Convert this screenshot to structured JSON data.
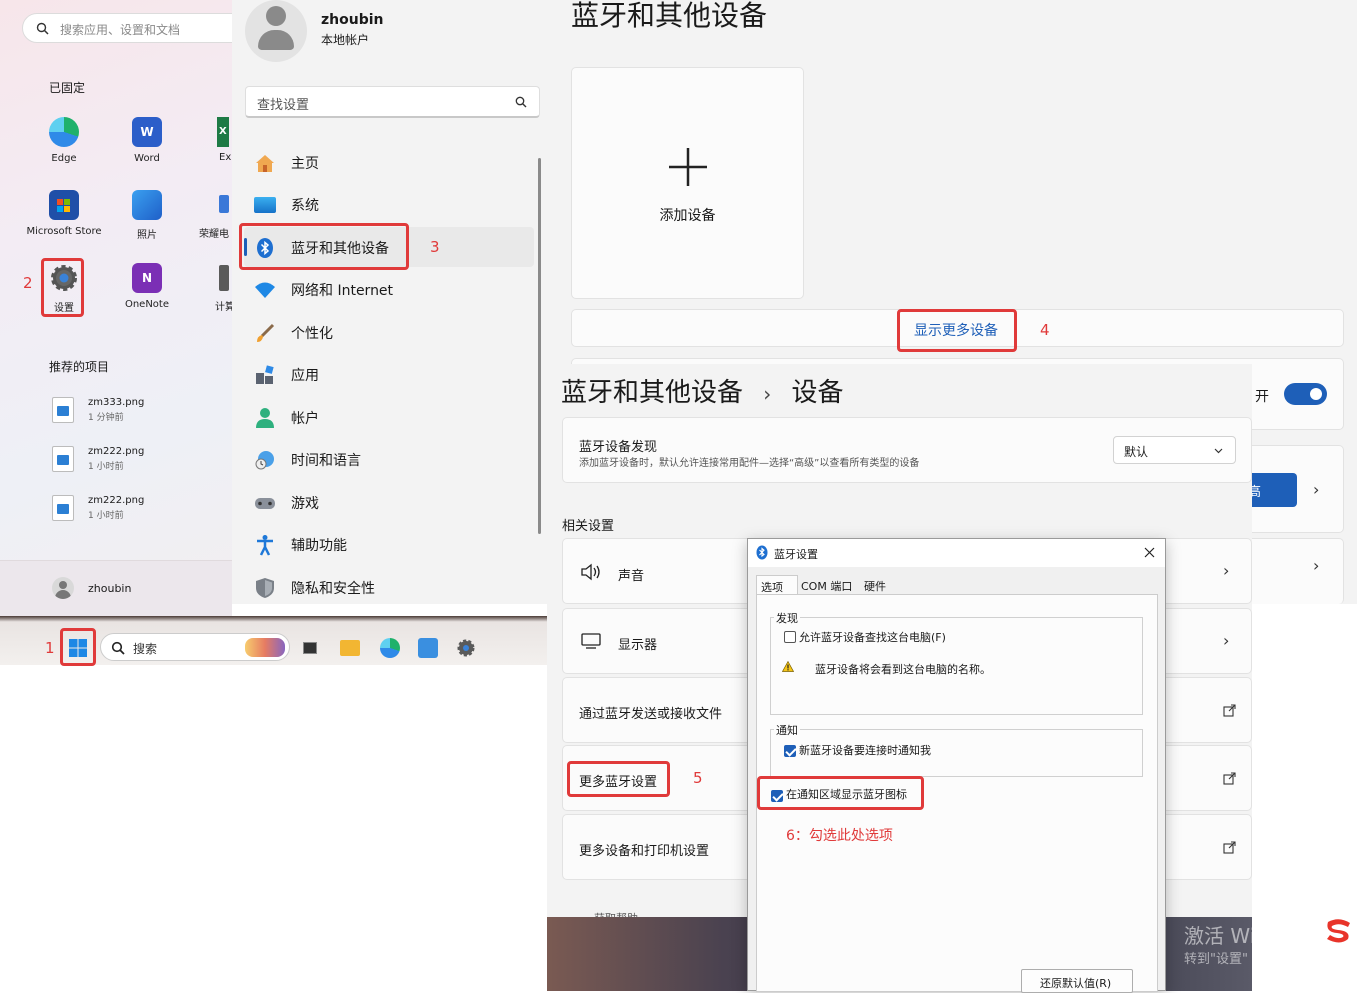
{
  "start_menu": {
    "search_placeholder": "搜索应用、设置和文档",
    "pinned_title": "已固定",
    "apps": [
      {
        "label": "Edge"
      },
      {
        "label": "Word"
      },
      {
        "label": "Ex"
      },
      {
        "label": "Microsoft Store"
      },
      {
        "label": "照片"
      },
      {
        "label": "荣耀电"
      },
      {
        "label": "设置"
      },
      {
        "label": "OneNote"
      },
      {
        "label": "计算"
      }
    ],
    "recommended_title": "推荐的项目",
    "recommended": [
      {
        "name": "zm333.png",
        "time": "1 分钟前"
      },
      {
        "name": "zm222.png",
        "time": "1 小时前"
      },
      {
        "name": "zm222.png",
        "time": "1 小时前"
      }
    ],
    "user": "zhoubin"
  },
  "taskbar": {
    "search_label": "搜索"
  },
  "settings": {
    "user_name": "zhoubin",
    "user_type": "本地帐户",
    "search_placeholder": "查找设置",
    "nav": [
      {
        "label": "主页"
      },
      {
        "label": "系统"
      },
      {
        "label": "蓝牙和其他设备"
      },
      {
        "label": "网络和 Internet"
      },
      {
        "label": "个性化"
      },
      {
        "label": "应用"
      },
      {
        "label": "帐户"
      },
      {
        "label": "时间和语言"
      },
      {
        "label": "游戏"
      },
      {
        "label": "辅助功能"
      },
      {
        "label": "隐私和安全性"
      }
    ]
  },
  "bt_page": {
    "title": "蓝牙和其他设备",
    "add_device": "添加设备",
    "show_more": "显示更多设备",
    "toggle_label": "开"
  },
  "devices_page": {
    "breadcrumb_parent": "蓝牙和其他设备",
    "breadcrumb_sep": "›",
    "breadcrumb_current": "设备",
    "discovery_title": "蓝牙设备发现",
    "discovery_desc": "添加蓝牙设备时，默认允许连接常用配件—选择“高级”以查看所有类型的设备",
    "discovery_value": "默认",
    "related_title": "相关设置",
    "related": [
      {
        "label": "声音"
      },
      {
        "label": "显示器"
      },
      {
        "label": "通过蓝牙发送或接收文件"
      },
      {
        "label": "更多蓝牙设置"
      },
      {
        "label": "更多设备和打印机设置"
      }
    ],
    "partial_button": "高",
    "help_partial": "获取帮助"
  },
  "dialog": {
    "title": "蓝牙设置",
    "tabs": [
      "选项",
      "COM 端口",
      "硬件"
    ],
    "group_discovery": "发现",
    "allow_find": "允许蓝牙设备查找这台电脑(F)",
    "warning_text": "蓝牙设备将会看到这台电脑的名称。",
    "group_notify": "通知",
    "notify_new": "新蓝牙设备要连接时通知我",
    "show_icon": "在通知区域显示蓝牙图标",
    "restore": "还原默认值(R)",
    "allow_find_checked": false,
    "notify_new_checked": true,
    "show_icon_checked": true
  },
  "annotations": {
    "step1": "1",
    "step2": "2",
    "step3": "3",
    "step4": "4",
    "step5": "5",
    "step6": "6：勾选此处选项"
  },
  "watermark": {
    "line1": "激活 Wi",
    "line2": "转到\"设置\""
  },
  "colors": {
    "accent": "#1e5fb8",
    "annotation_red": "#e03a3a",
    "toggle": "#1e5fb8"
  }
}
